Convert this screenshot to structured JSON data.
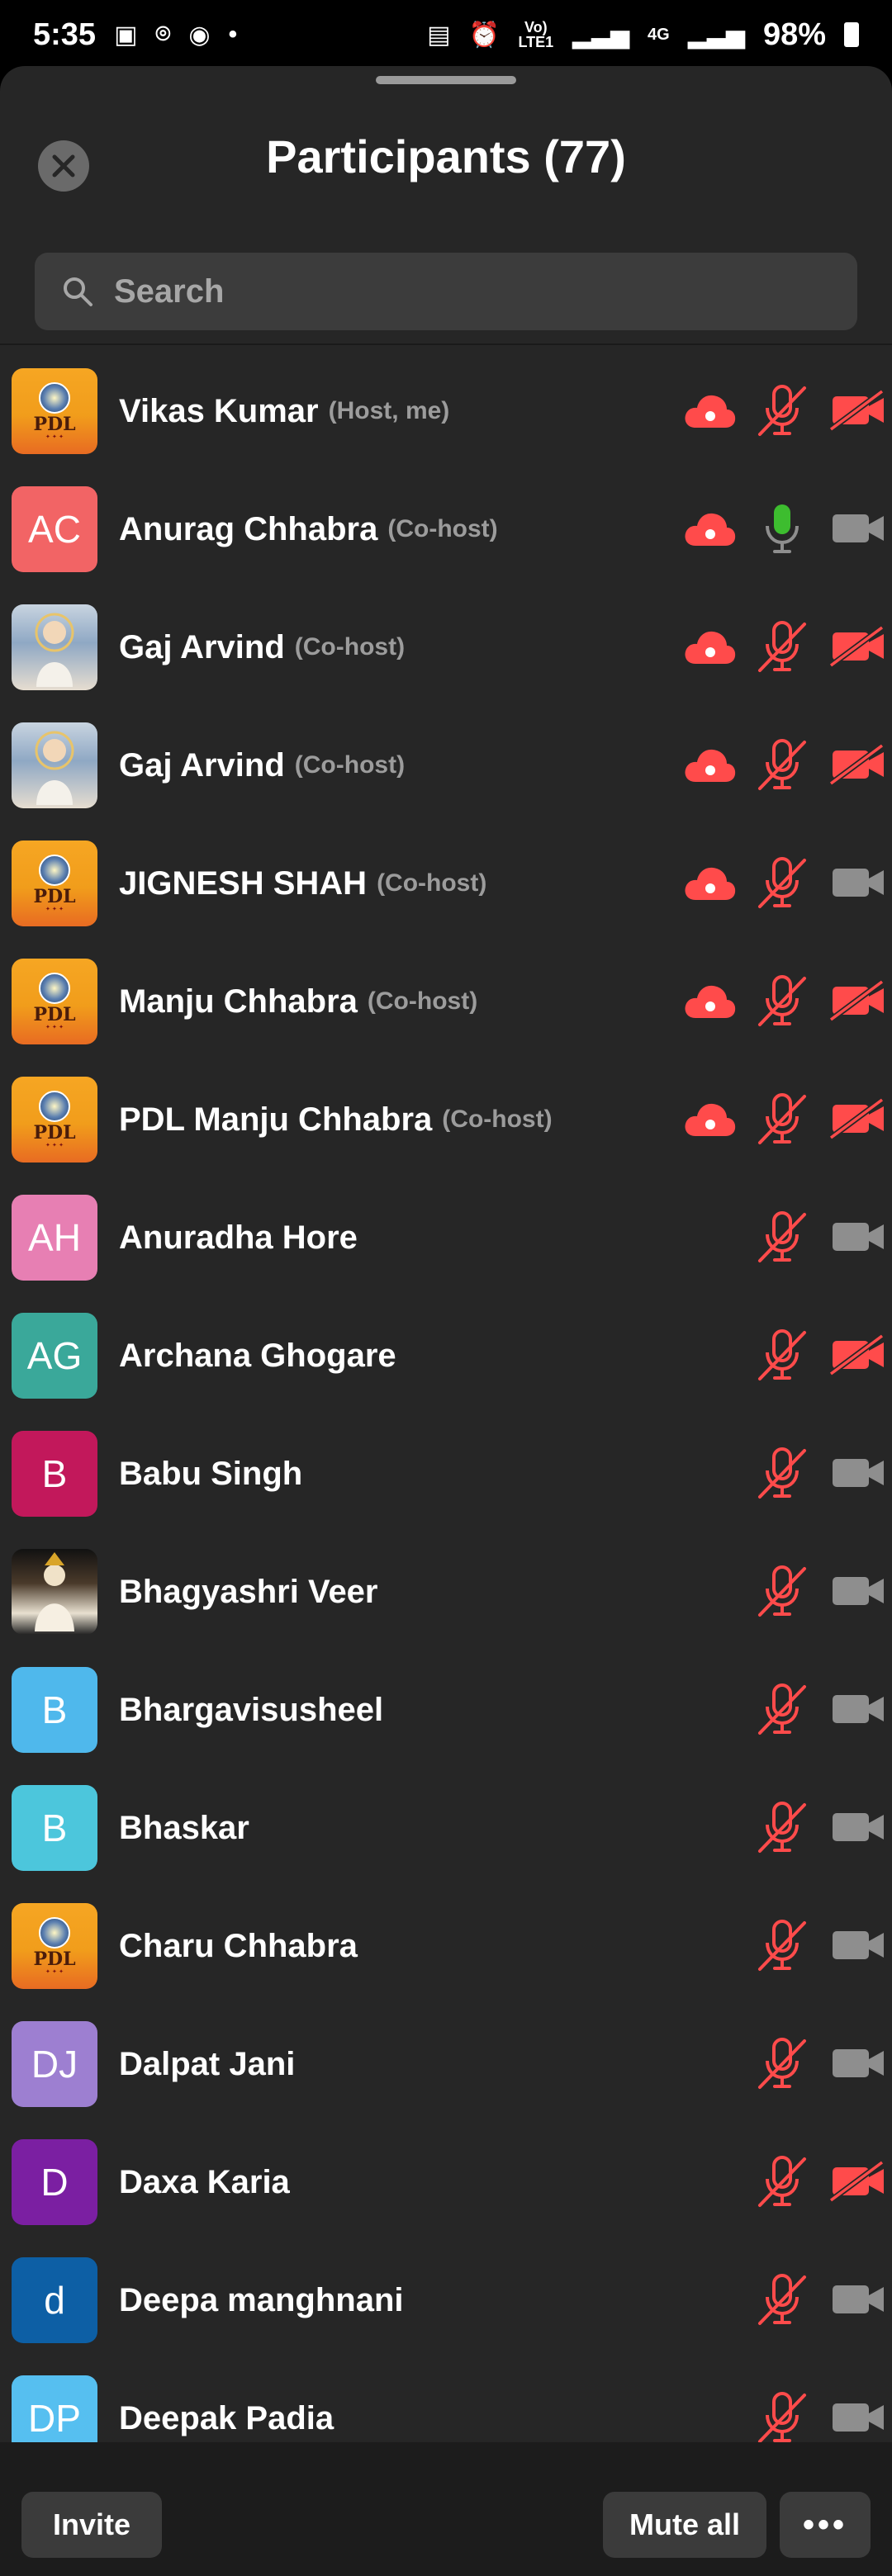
{
  "status_bar": {
    "time": "5:35",
    "network_label": "Vo) LTE1",
    "network_type": "4G",
    "battery": "98%"
  },
  "header": {
    "title": "Participants (77)",
    "close_icon": "close-icon"
  },
  "search": {
    "placeholder": "Search"
  },
  "colors": {
    "background": "#262626",
    "muted_red": "#ff4b4b",
    "active_green": "#3dbd2f",
    "icon_gray": "#8e8e8e"
  },
  "participants": [
    {
      "name": "Vikas Kumar",
      "role": "(Host, me)",
      "avatar_type": "logo",
      "avatar_text": "",
      "cloud": true,
      "mic": "muted",
      "video": "off"
    },
    {
      "name": "Anurag Chhabra",
      "role": "(Co-host)",
      "avatar_type": "initials",
      "avatar_text": "AC",
      "avatar_color": "#f26465",
      "cloud": true,
      "mic": "active",
      "video": "on"
    },
    {
      "name": "Gaj Arvind",
      "role": "(Co-host)",
      "avatar_type": "photo",
      "avatar_text": "",
      "cloud": true,
      "mic": "muted",
      "video": "off"
    },
    {
      "name": "Gaj Arvind",
      "role": "(Co-host)",
      "avatar_type": "photo",
      "avatar_text": "",
      "cloud": true,
      "mic": "muted",
      "video": "off"
    },
    {
      "name": "JIGNESH SHAH",
      "role": "(Co-host)",
      "avatar_type": "logo",
      "avatar_text": "",
      "cloud": true,
      "mic": "muted",
      "video": "on"
    },
    {
      "name": "Manju Chhabra",
      "role": "(Co-host)",
      "avatar_type": "logo",
      "avatar_text": "",
      "cloud": true,
      "mic": "muted",
      "video": "off"
    },
    {
      "name": "PDL Manju Chhabra",
      "role": "(Co-host)",
      "avatar_type": "logo",
      "avatar_text": "",
      "cloud": true,
      "mic": "muted",
      "video": "off"
    },
    {
      "name": "Anuradha Hore",
      "role": "",
      "avatar_type": "initials",
      "avatar_text": "AH",
      "avatar_color": "#e77fb3",
      "cloud": false,
      "mic": "muted",
      "video": "on"
    },
    {
      "name": "Archana Ghogare",
      "role": "",
      "avatar_type": "initials",
      "avatar_text": "AG",
      "avatar_color": "#3aa89a",
      "cloud": false,
      "mic": "muted",
      "video": "off"
    },
    {
      "name": "Babu Singh",
      "role": "",
      "avatar_type": "initials",
      "avatar_text": "B",
      "avatar_color": "#c2185b",
      "cloud": false,
      "mic": "muted",
      "video": "on"
    },
    {
      "name": "Bhagyashri Veer",
      "role": "",
      "avatar_type": "photo2",
      "avatar_text": "",
      "cloud": false,
      "mic": "muted",
      "video": "on"
    },
    {
      "name": "Bhargavisusheel",
      "role": "",
      "avatar_type": "initials",
      "avatar_text": "B",
      "avatar_color": "#4fb8ec",
      "cloud": false,
      "mic": "muted",
      "video": "on"
    },
    {
      "name": "Bhaskar",
      "role": "",
      "avatar_type": "initials",
      "avatar_text": "B",
      "avatar_color": "#4cc6dc",
      "cloud": false,
      "mic": "muted",
      "video": "on"
    },
    {
      "name": "Charu Chhabra",
      "role": "",
      "avatar_type": "logo",
      "avatar_text": "",
      "cloud": false,
      "mic": "muted",
      "video": "on"
    },
    {
      "name": "Dalpat Jani",
      "role": "",
      "avatar_type": "initials",
      "avatar_text": "DJ",
      "avatar_color": "#9d7fd1",
      "cloud": false,
      "mic": "muted",
      "video": "on"
    },
    {
      "name": "Daxa Karia",
      "role": "",
      "avatar_type": "initials",
      "avatar_text": "D",
      "avatar_color": "#7b1fa2",
      "cloud": false,
      "mic": "muted",
      "video": "off"
    },
    {
      "name": "Deepa manghnani",
      "role": "",
      "avatar_type": "initials",
      "avatar_text": "d",
      "avatar_color": "#0d5fa5",
      "cloud": false,
      "mic": "muted",
      "video": "on"
    },
    {
      "name": "Deepak Padia",
      "role": "",
      "avatar_type": "initials",
      "avatar_text": "DP",
      "avatar_color": "#56bff0",
      "cloud": false,
      "mic": "muted",
      "video": "on"
    }
  ],
  "footer": {
    "invite_label": "Invite",
    "mute_all_label": "Mute all",
    "more_label": "•••"
  }
}
